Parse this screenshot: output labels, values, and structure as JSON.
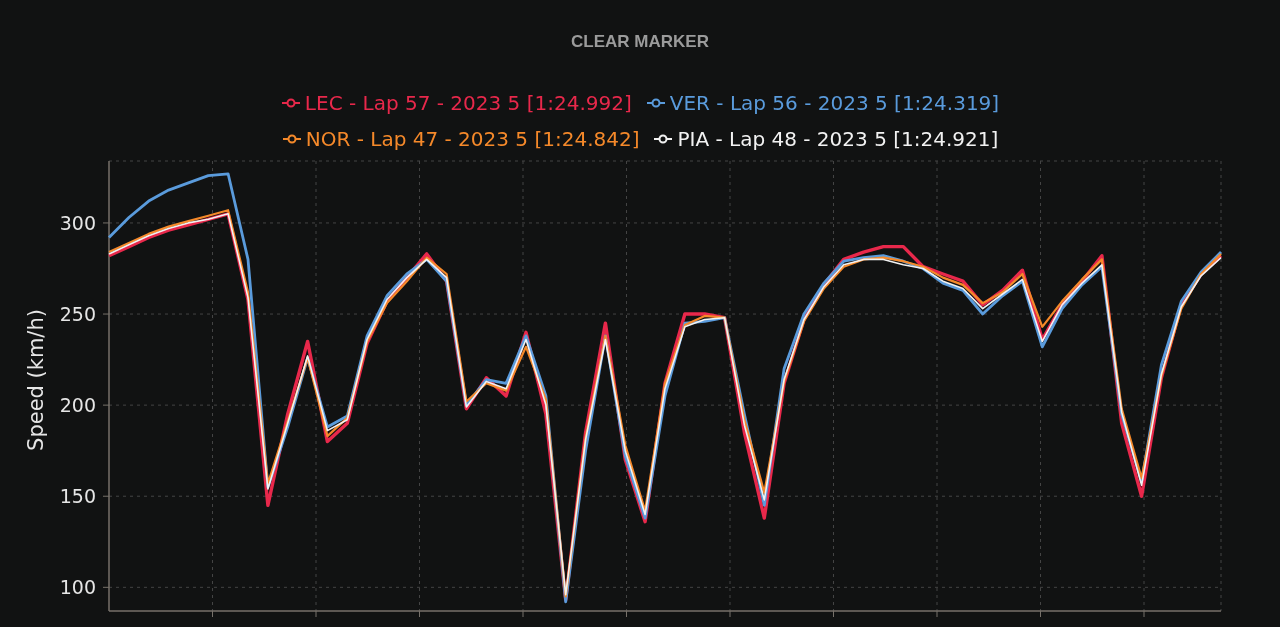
{
  "clear_button": {
    "label": "CLEAR MARKER"
  },
  "chart_data": {
    "type": "line",
    "grid": true,
    "ylabel": "Speed (km/h)",
    "ylim": [
      87,
      334
    ],
    "yticks": [
      100,
      150,
      200,
      250,
      300
    ],
    "series": [
      {
        "name": "LEC - Lap 57 - 2023 5 [1:24.992]",
        "color": "#e8284b",
        "values": [
          282,
          287,
          292,
          296,
          299,
          302,
          305,
          258,
          145,
          195,
          235,
          180,
          190,
          234,
          257,
          270,
          283,
          268,
          198,
          215,
          205,
          240,
          195,
          93,
          185,
          245,
          170,
          136,
          212,
          250,
          250,
          248,
          185,
          138,
          212,
          247,
          266,
          280,
          284,
          287,
          287,
          276,
          272,
          268,
          255,
          263,
          274,
          236,
          255,
          268,
          282,
          190,
          150,
          215,
          255,
          272,
          282
        ]
      },
      {
        "name": "VER - Lap 56 - 2023 5 [1:24.319]",
        "color": "#5a9bdc",
        "values": [
          292,
          303,
          312,
          318,
          322,
          326,
          327,
          280,
          155,
          188,
          226,
          188,
          194,
          238,
          260,
          272,
          280,
          268,
          200,
          214,
          212,
          238,
          205,
          92,
          175,
          238,
          172,
          138,
          205,
          245,
          246,
          248,
          195,
          145,
          220,
          250,
          267,
          279,
          281,
          282,
          279,
          275,
          267,
          263,
          250,
          260,
          268,
          232,
          253,
          266,
          276,
          195,
          158,
          222,
          257,
          273,
          284
        ]
      },
      {
        "name": "NOR - Lap 47 - 2023 5 [1:24.842]",
        "color": "#f5892a",
        "values": [
          284,
          289,
          294,
          298,
          301,
          304,
          307,
          262,
          157,
          191,
          226,
          183,
          193,
          235,
          256,
          268,
          281,
          272,
          202,
          212,
          208,
          232,
          203,
          95,
          182,
          238,
          178,
          142,
          212,
          244,
          249,
          248,
          192,
          152,
          213,
          246,
          264,
          276,
          280,
          281,
          279,
          276,
          270,
          266,
          256,
          262,
          272,
          243,
          257,
          269,
          280,
          198,
          160,
          216,
          253,
          272,
          283
        ]
      },
      {
        "name": "PIA - Lap 48 - 2023 5 [1:24.921]",
        "color": "#f2f2f2",
        "values": [
          283,
          288,
          293,
          297,
          300,
          302,
          305,
          259,
          154,
          190,
          227,
          186,
          192,
          236,
          258,
          270,
          280,
          270,
          199,
          213,
          209,
          236,
          200,
          96,
          181,
          236,
          175,
          140,
          209,
          243,
          247,
          248,
          189,
          148,
          214,
          247,
          265,
          277,
          280,
          280,
          277,
          275,
          268,
          264,
          253,
          261,
          269,
          235,
          255,
          267,
          277,
          196,
          156,
          217,
          254,
          271,
          281
        ]
      }
    ]
  }
}
